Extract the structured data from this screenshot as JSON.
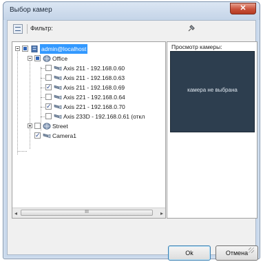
{
  "window": {
    "title": "Выбор камер",
    "close_glyph": "✕"
  },
  "filter": {
    "label": "Фильтр:"
  },
  "tree": {
    "root": {
      "label": "admin@localhost",
      "checked": "partial"
    },
    "office": {
      "label": "Office",
      "checked": "partial"
    },
    "cameras": [
      {
        "label": "Axis 211 - 192.168.0.60",
        "checked": false
      },
      {
        "label": "Axis 211 - 192.168.0.63",
        "checked": false
      },
      {
        "label": "Axis 211 - 192.168.0.69",
        "checked": true
      },
      {
        "label": "Axis 221 - 192.168.0.64",
        "checked": false
      },
      {
        "label": "Axis 221 - 192.168.0.70",
        "checked": true
      },
      {
        "label": "Axis 233D - 192.168.0.61 (откл",
        "checked": false
      }
    ],
    "street": {
      "label": "Street",
      "checked": false
    },
    "camera1": {
      "label": "Camera1",
      "checked": true
    },
    "scroll": {
      "left_arrow": "◂",
      "right_arrow": "▸",
      "thumb_grip": "III"
    }
  },
  "preview": {
    "label": "Просмотр камеры:",
    "empty_text": "камера не выбрана",
    "bg_color": "#2d3e4f"
  },
  "buttons": {
    "ok": "Ok",
    "cancel": "Отмена"
  },
  "check_glyph": "✓"
}
